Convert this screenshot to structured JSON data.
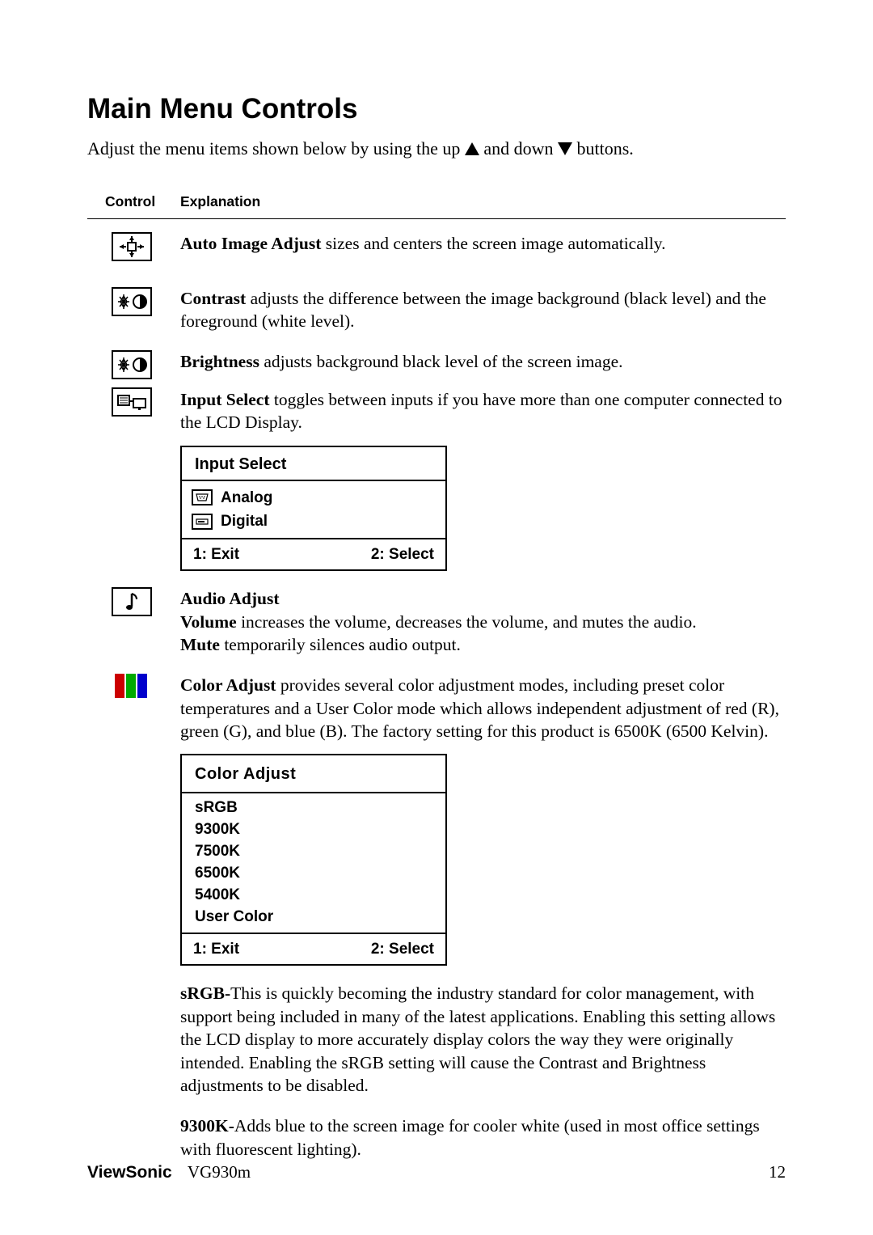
{
  "title": "Main Menu Controls",
  "intro_a": "Adjust the menu items shown below by using the up ",
  "intro_b": " and down ",
  "intro_c": " buttons.",
  "headers": {
    "control": "Control",
    "explanation": "Explanation"
  },
  "items": {
    "auto": {
      "term": "Auto Image Adjust",
      "desc": " sizes and centers the screen image automatically."
    },
    "contrast": {
      "term": "Contrast",
      "desc": " adjusts the difference between the image background  (black level) and the foreground (white level)."
    },
    "brightness": {
      "term": "Brightness",
      "desc": " adjusts background black level of the screen image."
    },
    "input": {
      "term": "Input Select",
      "desc": " toggles between inputs if you have more than one computer connected to the LCD Display."
    },
    "audio": {
      "term": "Audio Adjust",
      "vol_term": "Volume",
      "vol_desc": " increases the volume, decreases the volume, and mutes the audio.",
      "mute_term": "Mute",
      "mute_desc": " temporarily silences audio output."
    },
    "color": {
      "term": "Color Adjust",
      "desc": " provides several color adjustment modes, including preset color temperatures and a User Color mode which allows independent adjustment of red (R), green (G), and blue (B). The factory setting for this product is 6500K (6500 Kelvin)."
    }
  },
  "osd_input": {
    "title": "Input Select",
    "opt1": "Analog",
    "opt2": "Digital",
    "foot_left": "1: Exit",
    "foot_right": "2: Select"
  },
  "osd_color": {
    "title": "Color Adjust",
    "opts": [
      "sRGB",
      "9300K",
      "7500K",
      "6500K",
      "5400K",
      "User Color"
    ],
    "foot_left": "1: Exit",
    "foot_right": "2: Select"
  },
  "srgb": {
    "term": "sRGB-",
    "desc": "This is quickly becoming the industry standard for color management, with support being included in many of the latest applications. Enabling this setting allows the LCD display to more accurately display colors the way they were originally intended. Enabling the sRGB setting will cause the Contrast and Brightness adjustments to be disabled."
  },
  "k9300": {
    "term": "9300K-",
    "desc": "Adds blue to the screen image for cooler white (used in most office settings with fluorescent lighting)."
  },
  "footer": {
    "brand": "ViewSonic",
    "model": "VG930m",
    "page": "12"
  }
}
